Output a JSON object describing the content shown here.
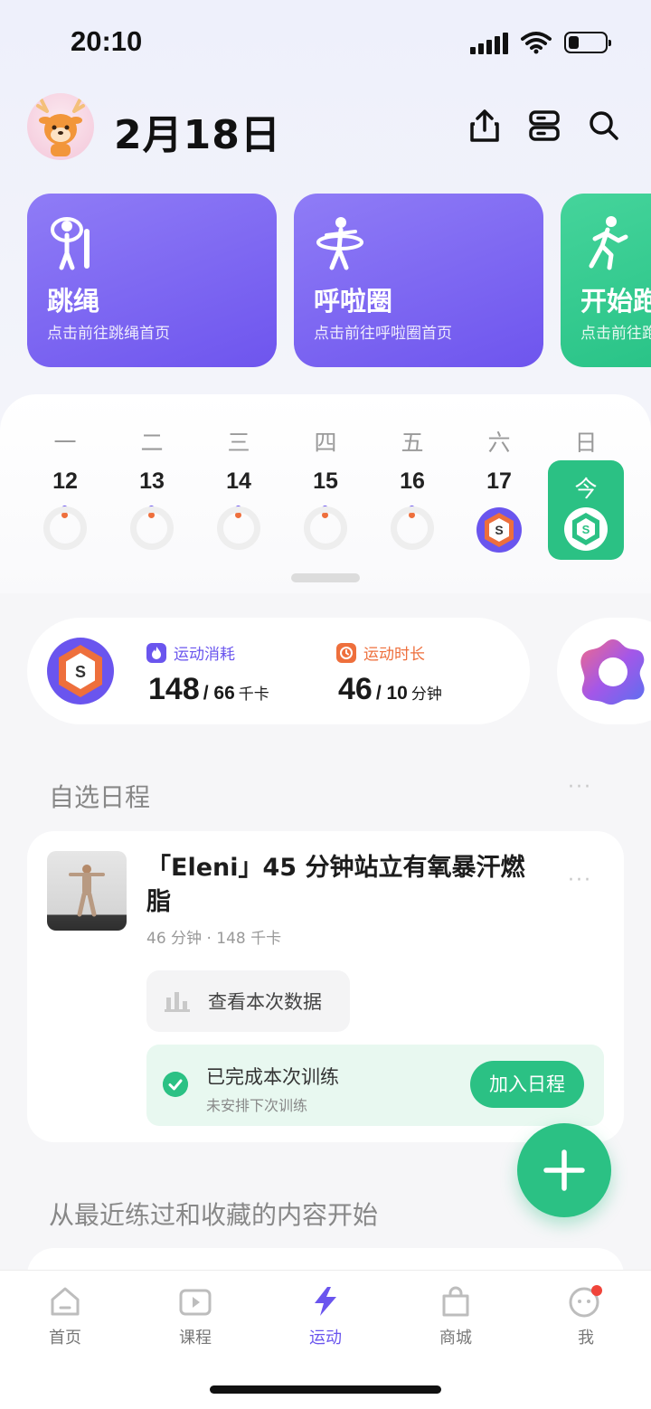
{
  "status_bar": {
    "time": "20:10",
    "battery_level": 0.3
  },
  "header": {
    "date": "2月18日"
  },
  "sport_cards": [
    {
      "title": "跳绳",
      "subtitle": "点击前往跳绳首页",
      "color": "#7b62f2",
      "icon": "jump-rope-icon"
    },
    {
      "title": "呼啦圈",
      "subtitle": "点击前往呼啦圈首页",
      "color": "#7b62f2",
      "icon": "hula-hoop-icon"
    },
    {
      "title": "开始跑",
      "subtitle": "点击前往跑",
      "color": "#2bc184",
      "icon": "running-icon"
    }
  ],
  "calendar": {
    "weekdays": [
      "一",
      "二",
      "三",
      "四",
      "五",
      "六",
      "日"
    ],
    "days": [
      "12",
      "13",
      "14",
      "15",
      "16",
      "17"
    ],
    "today_label": "今"
  },
  "stats": {
    "calories": {
      "label": "运动消耗",
      "value": "148",
      "goal": "/ 66",
      "unit": "千卡"
    },
    "duration": {
      "label": "运动时长",
      "value": "46",
      "goal": "/ 10",
      "unit": "分钟"
    },
    "badge_letter": "S"
  },
  "schedule": {
    "section_title": "自选日程",
    "more": "···",
    "item": {
      "title": "「Eleni」45 分钟站立有氧暴汗燃脂",
      "meta": "46 分钟 · 148 千卡",
      "view_data_label": "查看本次数据",
      "done_title": "已完成本次训练",
      "done_sub": "未安排下次训练",
      "join_label": "加入日程"
    }
  },
  "recent": {
    "section_title": "从最近练过和收藏的内容开始"
  },
  "tabbar": {
    "items": [
      {
        "label": "首页",
        "icon": "home-icon"
      },
      {
        "label": "课程",
        "icon": "course-icon"
      },
      {
        "label": "运动",
        "icon": "lightning-icon",
        "active": true
      },
      {
        "label": "商城",
        "icon": "shop-bag-icon"
      },
      {
        "label": "我",
        "icon": "profile-icon"
      }
    ]
  },
  "colors": {
    "accent_green": "#2bc184",
    "accent_purple": "#6a55ee",
    "badge_orange": "#ee6f3c"
  }
}
